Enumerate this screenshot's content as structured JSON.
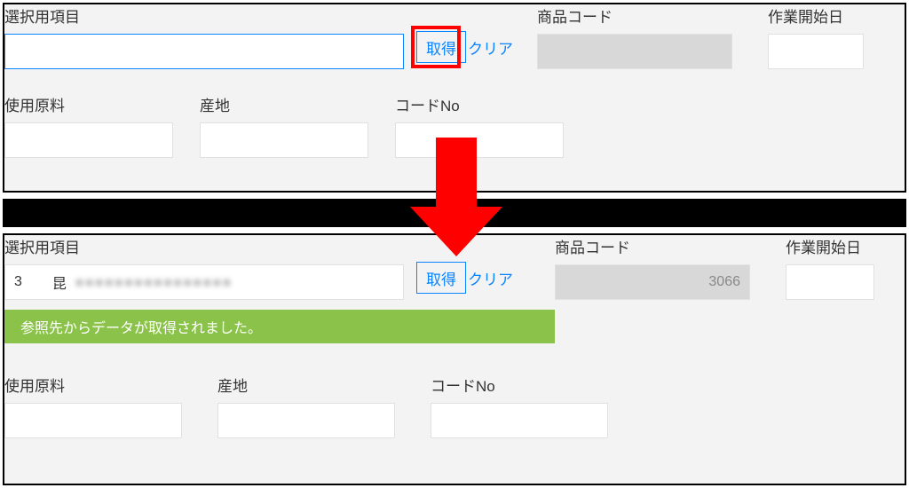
{
  "labels": {
    "selection_item": "選択用項目",
    "product_code": "商品コード",
    "work_start_date": "作業開始日",
    "raw_material": "使用原料",
    "origin": "産地",
    "code_no": "コードNo"
  },
  "buttons": {
    "fetch": "取得",
    "clear": "クリア"
  },
  "top": {
    "selection_value": "",
    "product_code": "",
    "work_start_date": "",
    "raw_material": "",
    "origin": "",
    "code_no": ""
  },
  "bottom": {
    "selection_prefix": "3",
    "selection_value_visible": "昆",
    "selection_blurred": "■■■■■■■■■■■■■■■■",
    "product_code": "3066",
    "work_start_date": "",
    "raw_material": "",
    "origin": "",
    "code_no": "",
    "success_message": "参照先からデータが取得されました。"
  }
}
